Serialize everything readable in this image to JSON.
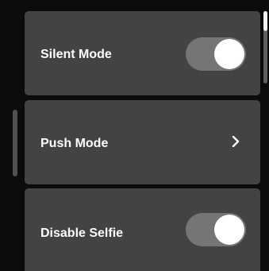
{
  "settings": {
    "items": [
      {
        "label": "Silent Mode",
        "control": "toggle",
        "state": "on"
      },
      {
        "label": "Push Mode",
        "control": "chevron",
        "icon": "chevron-right-icon"
      },
      {
        "label": "Disable Selfie",
        "control": "toggle",
        "state": "on"
      }
    ]
  },
  "colors": {
    "background": "#0b0b0b",
    "card": "#434343",
    "toggle_track": "#757575",
    "toggle_knob": "#ffffff",
    "text": "#ffffff"
  }
}
